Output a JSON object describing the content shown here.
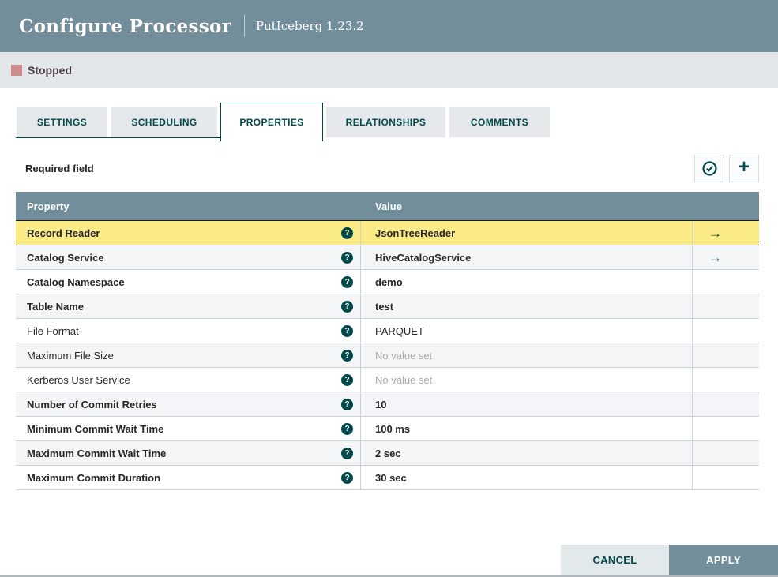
{
  "header": {
    "title": "Configure Processor",
    "subtitle": "PutIceberg 1.23.2"
  },
  "status": {
    "label": "Stopped"
  },
  "tabs": {
    "settings": "SETTINGS",
    "scheduling": "SCHEDULING",
    "properties": "PROPERTIES",
    "relationships": "RELATIONSHIPS",
    "comments": "COMMENTS",
    "active": "PROPERTIES"
  },
  "toolbar": {
    "required_label": "Required field",
    "verify_icon": "check-circle-icon",
    "add_icon": "plus-icon"
  },
  "table": {
    "columns": {
      "property": "Property",
      "value": "Value"
    },
    "rows": [
      {
        "property": "Record Reader",
        "value": "JsonTreeReader",
        "required": true,
        "selected": true,
        "link": true
      },
      {
        "property": "Catalog Service",
        "value": "HiveCatalogService",
        "required": true,
        "link": true
      },
      {
        "property": "Catalog Namespace",
        "value": "demo",
        "required": true
      },
      {
        "property": "Table Name",
        "value": "test",
        "required": true
      },
      {
        "property": "File Format",
        "value": "PARQUET",
        "required": false
      },
      {
        "property": "Maximum File Size",
        "value": "No value set",
        "required": false,
        "unset": true
      },
      {
        "property": "Kerberos User Service",
        "value": "No value set",
        "required": false,
        "unset": true
      },
      {
        "property": "Number of Commit Retries",
        "value": "10",
        "required": true
      },
      {
        "property": "Minimum Commit Wait Time",
        "value": "100 ms",
        "required": true
      },
      {
        "property": "Maximum Commit Wait Time",
        "value": "2 sec",
        "required": true
      },
      {
        "property": "Maximum Commit Duration",
        "value": "30 sec",
        "required": true
      }
    ]
  },
  "footer": {
    "cancel_label": "CANCEL",
    "apply_label": "APPLY"
  },
  "colors": {
    "header_bg": "#728e9b",
    "accent_teal": "#004849",
    "selected_row": "#faeb87",
    "stopped_square": "#cc8b8d",
    "alt_row": "#f3f5f6"
  }
}
